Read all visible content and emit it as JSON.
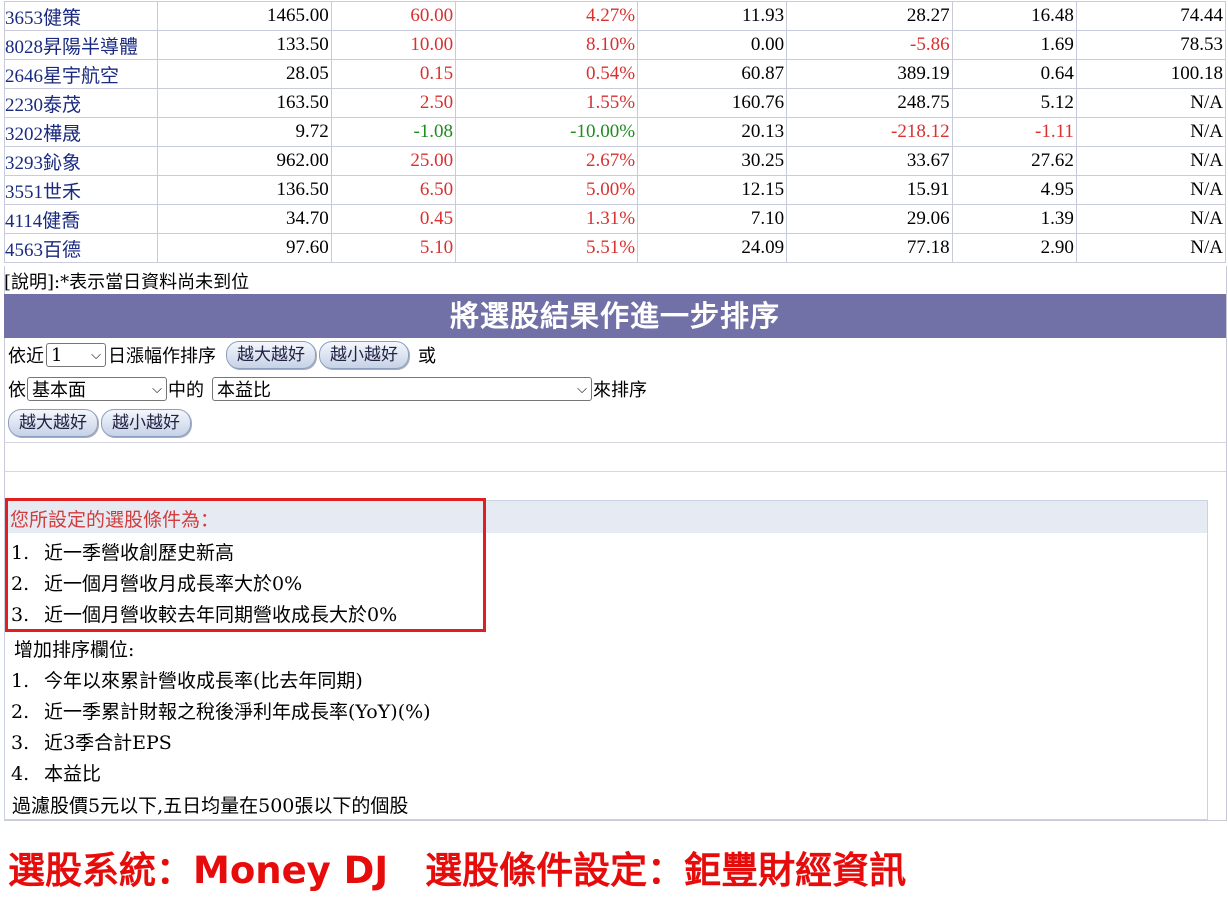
{
  "stocks": [
    {
      "name": "3653健策",
      "c1": "1465.00",
      "c2": "60.00",
      "c3": "4.27%",
      "c4": "11.93",
      "c5": "28.27",
      "c6": "16.48",
      "c7": "74.44",
      "t2": "up",
      "t3": "up",
      "t5": "",
      "t6": ""
    },
    {
      "name": "8028昇陽半導體",
      "c1": "133.50",
      "c2": "10.00",
      "c3": "8.10%",
      "c4": "0.00",
      "c5": "-5.86",
      "c6": "1.69",
      "c7": "78.53",
      "t2": "up",
      "t3": "up",
      "t5": "up",
      "t6": ""
    },
    {
      "name": "2646星宇航空",
      "c1": "28.05",
      "c2": "0.15",
      "c3": "0.54%",
      "c4": "60.87",
      "c5": "389.19",
      "c6": "0.64",
      "c7": "100.18",
      "t2": "up",
      "t3": "up",
      "t5": "",
      "t6": ""
    },
    {
      "name": "2230泰茂",
      "c1": "163.50",
      "c2": "2.50",
      "c3": "1.55%",
      "c4": "160.76",
      "c5": "248.75",
      "c6": "5.12",
      "c7": "N/A",
      "t2": "up",
      "t3": "up",
      "t5": "",
      "t6": ""
    },
    {
      "name": "3202樺晟",
      "c1": "9.72",
      "c2": "-1.08",
      "c3": "-10.00%",
      "c4": "20.13",
      "c5": "-218.12",
      "c6": "-1.11",
      "c7": "N/A",
      "t2": "down",
      "t3": "down",
      "t5": "up",
      "t6": "up"
    },
    {
      "name": "3293鈊象",
      "c1": "962.00",
      "c2": "25.00",
      "c3": "2.67%",
      "c4": "30.25",
      "c5": "33.67",
      "c6": "27.62",
      "c7": "N/A",
      "t2": "up",
      "t3": "up",
      "t5": "",
      "t6": ""
    },
    {
      "name": "3551世禾",
      "c1": "136.50",
      "c2": "6.50",
      "c3": "5.00%",
      "c4": "12.15",
      "c5": "15.91",
      "c6": "4.95",
      "c7": "N/A",
      "t2": "up",
      "t3": "up",
      "t5": "",
      "t6": ""
    },
    {
      "name": "4114健喬",
      "c1": "34.70",
      "c2": "0.45",
      "c3": "1.31%",
      "c4": "7.10",
      "c5": "29.06",
      "c6": "1.39",
      "c7": "N/A",
      "t2": "up",
      "t3": "up",
      "t5": "",
      "t6": ""
    },
    {
      "name": "4563百德",
      "c1": "97.60",
      "c2": "5.10",
      "c3": "5.51%",
      "c4": "24.09",
      "c5": "77.18",
      "c6": "2.90",
      "c7": "N/A",
      "t2": "up",
      "t3": "up",
      "t5": "",
      "t6": ""
    }
  ],
  "note": "[說明]:*表示當日資料尚未到位",
  "sort_header": "將選股結果作進一步排序",
  "sort_row1": {
    "prefix": "依近",
    "days": "1",
    "suffix": "日漲幅作排序",
    "btn_desc": "越大越好",
    "btn_asc": "越小越好",
    "or": "或"
  },
  "sort_row2": {
    "prefix": "依",
    "category": "基本面",
    "middle": "中的",
    "field": "本益比",
    "suffix": "來排序"
  },
  "sort_row3": {
    "btn_desc": "越大越好",
    "btn_asc": "越小越好"
  },
  "conditions_title": "您所設定的選股條件為：",
  "conditions": [
    {
      "n": "1.",
      "text": "近一季營收創歷史新高"
    },
    {
      "n": "2.",
      "text": "近一個月營收月成長率大於0%"
    },
    {
      "n": "3.",
      "text": "近一個月營收較去年同期營收成長大於0%"
    }
  ],
  "extra_title": "增加排序欄位:",
  "extra_fields": [
    {
      "n": "1.",
      "text": "今年以來累計營收成長率(比去年同期)"
    },
    {
      "n": "2.",
      "text": "近一季累計財報之稅後淨利年成長率(YoY)(%)"
    },
    {
      "n": "3.",
      "text": "近3季合計EPS"
    },
    {
      "n": "4.",
      "text": "本益比"
    }
  ],
  "filter_note": "過濾股價5元以下,五日均量在500張以下的個股",
  "footer": "選股系統：Money DJ　選股條件設定：鉅豐財經資訊"
}
